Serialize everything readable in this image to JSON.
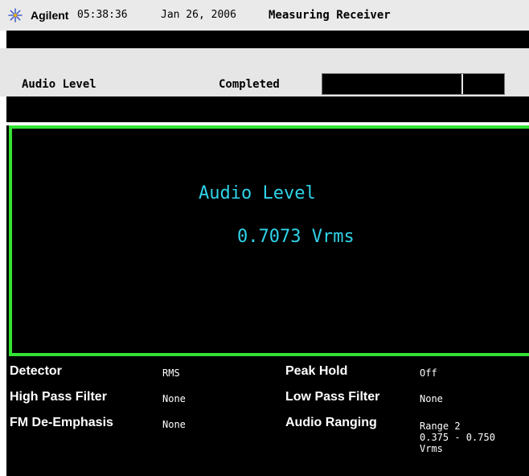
{
  "header": {
    "logo_icon": "agilent-spark-icon",
    "brand": "Agilent",
    "time": "05:38:36",
    "date": "Jan 26, 2006",
    "app_title": "Measuring Receiver"
  },
  "measurement_bar": {
    "name": "Audio Level",
    "status": "Completed",
    "progress_fraction": 1.0
  },
  "display": {
    "title": "Audio Level",
    "value": "0.7073 Vrms",
    "text_color": "#2fd3e8",
    "frame_color": "#33e233"
  },
  "params": {
    "detector_label": "Detector",
    "detector_value": "RMS",
    "peak_hold_label": "Peak Hold",
    "peak_hold_value": "Off",
    "hpf_label": "High Pass Filter",
    "hpf_value": "None",
    "lpf_label": "Low Pass Filter",
    "lpf_value": "None",
    "deemph_label": "FM De-Emphasis",
    "deemph_value": "None",
    "ranging_label": "Audio Ranging",
    "ranging_value_line1": "Range 2",
    "ranging_value_line2": "0.375 - 0.750",
    "ranging_value_line3": "Vrms"
  }
}
